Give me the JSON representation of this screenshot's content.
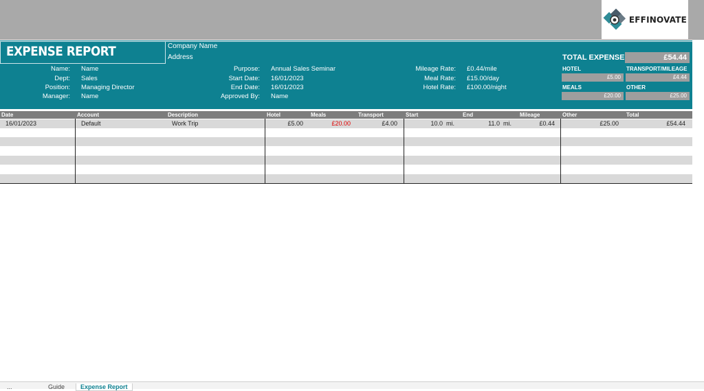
{
  "logo": {
    "text": "EFFINOVATE",
    "icon": "puzzle-gear-logo-icon"
  },
  "report": {
    "title": "EXPENSE REPORT",
    "company": "Company Name",
    "address": "Address"
  },
  "employee": {
    "name_label": "Name:",
    "name": "Name",
    "dept_label": "Dept:",
    "dept": "Sales",
    "position_label": "Position:",
    "position": "Managing Director",
    "manager_label": "Manager:",
    "manager": "Name"
  },
  "trip": {
    "purpose_label": "Purpose:",
    "purpose": "Annual Sales Seminar",
    "start_label": "Start Date:",
    "start": "16/01/2023",
    "end_label": "End Date:",
    "end": "16/01/2023",
    "approved_label": "Approved By:",
    "approved": "Name"
  },
  "rates": {
    "mileage_label": "Mileage Rate:",
    "mileage": "£0.44/mile",
    "meal_label": "Meal Rate:",
    "meal": "£15.00/day",
    "hotel_label": "Hotel Rate:",
    "hotel": "£100.00/night"
  },
  "totals": {
    "label": "TOTAL EXPENSES",
    "value": "£54.44",
    "hotel_label": "HOTEL",
    "hotel": "£5.00",
    "transport_label": "TRANSPORT/MILEAGE",
    "transport": "£4.44",
    "meals_label": "MEALS",
    "meals": "£20.00",
    "other_label": "OTHER",
    "other": "£25.00"
  },
  "table": {
    "headers": {
      "date": "Date",
      "account": "Account",
      "description": "Description",
      "hotel": "Hotel",
      "meals": "Meals",
      "transport": "Transport",
      "start": "Start",
      "end": "End",
      "mileage": "Mileage",
      "other": "Other",
      "total": "Total"
    },
    "rows": [
      {
        "date": "16/01/2023",
        "account": "Default",
        "description": "Work Trip",
        "hotel": "£5.00",
        "meals": "£20.00",
        "transport": "£4.00",
        "start": "10.0",
        "start_unit": "mi.",
        "end": "11.0",
        "end_unit": "mi.",
        "mileage": "£0.44",
        "other": "£25.00",
        "total": "£54.44"
      }
    ]
  },
  "colors": {
    "teal": "#0e8191",
    "meals_red": "#e00000"
  },
  "sheet_tabs": [
    "...",
    "Guide",
    "Expense Report"
  ]
}
